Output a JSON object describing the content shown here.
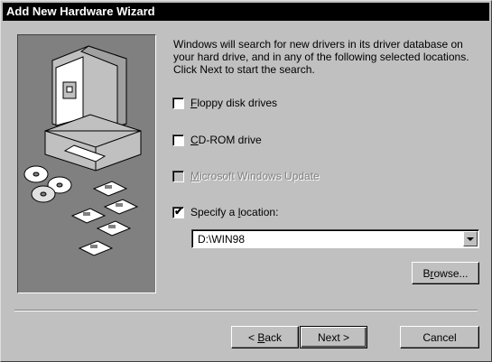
{
  "window": {
    "title": "Add New Hardware Wizard"
  },
  "intro_text": "Windows will search for new drivers in its driver database on your hard drive, and in any of the following selected locations. Click Next to start the search.",
  "options": [
    {
      "accel": "F",
      "rest": "loppy disk drives",
      "checked": false,
      "enabled": true
    },
    {
      "accel": "C",
      "rest": "D-ROM drive",
      "checked": false,
      "enabled": true
    },
    {
      "accel": "M",
      "rest": "icrosoft Windows Update",
      "checked": false,
      "enabled": false
    },
    {
      "prefix": "Specify a ",
      "accel": "l",
      "rest": "ocation:",
      "checked": true,
      "enabled": true
    }
  ],
  "location": {
    "value": "D:\\WIN98"
  },
  "buttons": {
    "browse_pre": "B",
    "browse_accel": "r",
    "browse_rest": "owse...",
    "back_pre": "< ",
    "back_accel": "B",
    "back_rest": "ack",
    "next": "Next >",
    "cancel": "Cancel"
  },
  "check_glyph": "✔",
  "colors": {
    "face": "#c0c0c0",
    "titlebar": "#000000",
    "art_bg": "#808080"
  }
}
